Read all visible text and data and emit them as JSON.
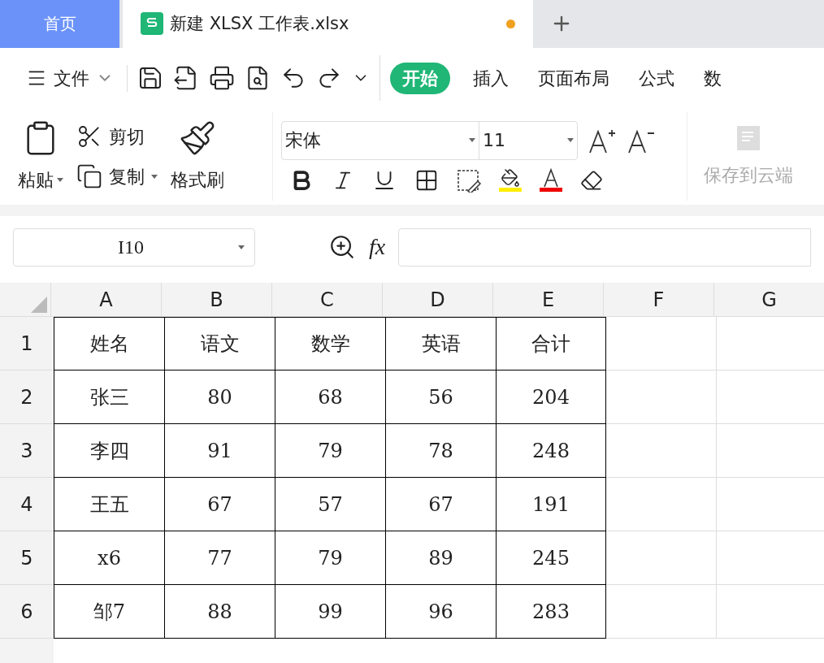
{
  "tabs": [
    {
      "label": "首页",
      "kind": "home",
      "selected": false
    },
    {
      "label": "新建 XLSX 工作表.xlsx",
      "kind": "file",
      "selected": true,
      "modified": true
    }
  ],
  "menu": {
    "file_label": "文件",
    "ribbon_tabs": [
      {
        "label": "开始",
        "selected": true
      },
      {
        "label": "插入",
        "selected": false
      },
      {
        "label": "页面布局",
        "selected": false
      },
      {
        "label": "公式",
        "selected": false
      },
      {
        "label": "数",
        "selected": false
      }
    ]
  },
  "clipboard": {
    "paste": "粘贴",
    "cut": "剪切",
    "copy": "复制",
    "format_painter": "格式刷"
  },
  "font": {
    "name": "宋体",
    "size": "11"
  },
  "cloud": {
    "label": "保存到云端",
    "disabled": true
  },
  "formula_bar": {
    "name_box": "I10",
    "fx": "fx"
  },
  "columns": [
    "A",
    "B",
    "C",
    "D",
    "E",
    "F",
    "G"
  ],
  "rows": [
    {
      "number": "1",
      "cells": [
        "姓名",
        "语文",
        "数学",
        "英语",
        "合计"
      ]
    },
    {
      "number": "2",
      "cells": [
        "张三",
        "80",
        "68",
        "56",
        "204"
      ]
    },
    {
      "number": "3",
      "cells": [
        "李四",
        "91",
        "79",
        "78",
        "248"
      ]
    },
    {
      "number": "4",
      "cells": [
        "王五",
        "67",
        "57",
        "67",
        "191"
      ]
    },
    {
      "number": "5",
      "cells": [
        "x6",
        "77",
        "79",
        "89",
        "245"
      ]
    },
    {
      "number": "6",
      "cells": [
        "邹7",
        "88",
        "99",
        "96",
        "283"
      ]
    }
  ]
}
